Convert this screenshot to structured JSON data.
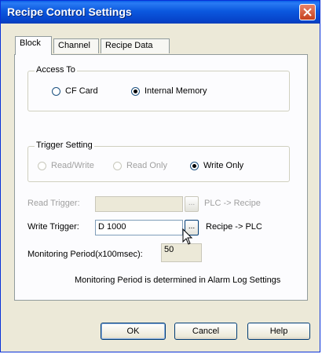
{
  "window": {
    "title": "Recipe Control Settings"
  },
  "tabs": [
    {
      "label": "Block",
      "active": true
    },
    {
      "label": "Channel",
      "active": false
    },
    {
      "label": "Recipe Data",
      "active": false
    }
  ],
  "access_to": {
    "label": "Access To",
    "options": [
      {
        "label": "CF Card",
        "checked": false
      },
      {
        "label": "Internal Memory",
        "checked": true
      }
    ]
  },
  "trigger_setting": {
    "label": "Trigger Setting",
    "options": [
      {
        "label": "Read/Write",
        "checked": false,
        "enabled": false
      },
      {
        "label": "Read Only",
        "checked": false,
        "enabled": false
      },
      {
        "label": "Write Only",
        "checked": true,
        "enabled": true
      }
    ]
  },
  "read_trigger": {
    "label": "Read Trigger:",
    "value": "",
    "button": "...",
    "direction": "PLC -> Recipe"
  },
  "write_trigger": {
    "label": "Write Trigger:",
    "value": "D 1000",
    "button": "...",
    "direction": "Recipe -> PLC"
  },
  "monitoring": {
    "label": "Monitoring Period(x100msec):",
    "value": "50",
    "note": "Monitoring Period is determined in Alarm Log Settings"
  },
  "buttons": {
    "ok": "OK",
    "cancel": "Cancel",
    "help": "Help"
  },
  "colors": {
    "titlebar": "#0a5fe8",
    "face": "#ece9d8",
    "checked_radio": "#21a121"
  }
}
